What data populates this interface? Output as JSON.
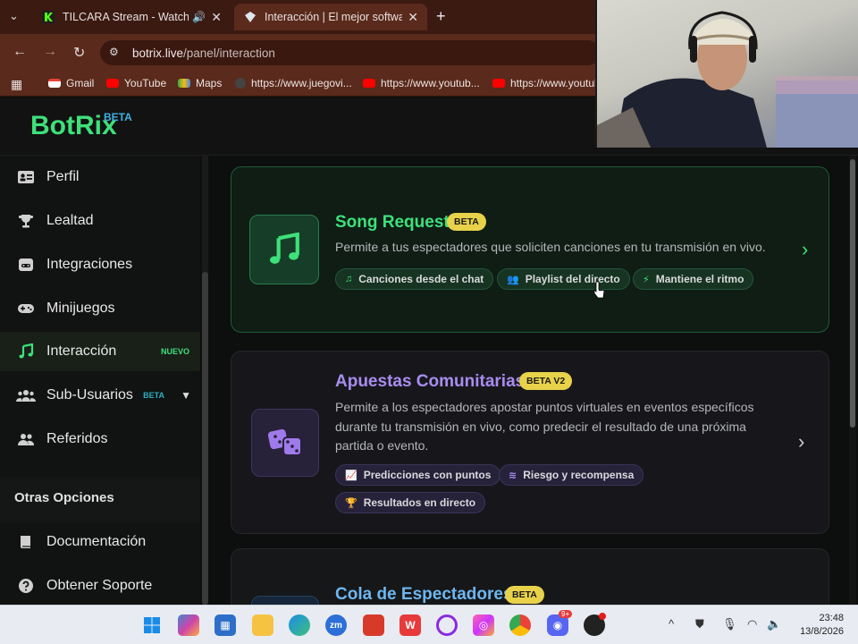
{
  "browser": {
    "tabs": [
      {
        "title": "TILCARA Stream - Watch Live",
        "favicon": "kick-icon",
        "active": false,
        "audio": true
      },
      {
        "title": "Interacción | El mejor software p",
        "favicon": "botrix-icon",
        "active": true,
        "audio": false
      }
    ],
    "url_host": "botrix.live",
    "url_path": "/panel/interaction",
    "bookmarks": [
      {
        "label": "Gmail",
        "icon": "gmail-icon"
      },
      {
        "label": "YouTube",
        "icon": "youtube-icon"
      },
      {
        "label": "Maps",
        "icon": "maps-icon"
      },
      {
        "label": "https://www.juegovi...",
        "icon": "site-icon"
      },
      {
        "label": "https://www.youtub...",
        "icon": "youtube-icon"
      },
      {
        "label": "https://www.youtub",
        "icon": "youtube-icon"
      }
    ]
  },
  "app": {
    "brand": "BotRix",
    "brand_badge": "BETA"
  },
  "sidebar": {
    "items": [
      {
        "label": "Perfil",
        "icon": "id-card-icon"
      },
      {
        "label": "Lealtad",
        "icon": "trophy-icon"
      },
      {
        "label": "Integraciones",
        "icon": "discord-icon"
      },
      {
        "label": "Minijuegos",
        "icon": "gamepad-icon"
      },
      {
        "label": "Interacción",
        "icon": "music-icon",
        "badge": "NUEVO",
        "active": true
      },
      {
        "label": "Sub-Usuarios",
        "icon": "users-icon",
        "badge": "BETA"
      },
      {
        "label": "Referidos",
        "icon": "user-group-icon"
      }
    ],
    "section_title": "Otras Opciones",
    "other_items": [
      {
        "label": "Documentación",
        "icon": "book-icon"
      },
      {
        "label": "Obtener Soporte",
        "icon": "question-icon"
      }
    ]
  },
  "cards": [
    {
      "title": "Song Request",
      "badge": "BETA",
      "description": "Permite a tus espectadores que soliciten canciones en tu transmisión en vivo.",
      "chips": [
        "Canciones desde el chat",
        "Playlist del directo",
        "Mantiene el ritmo"
      ],
      "accent": "#3ee07a"
    },
    {
      "title": "Apuestas Comunitarias",
      "badge": "BETA V2",
      "description_lines": [
        "Permite a los espectadores apostar puntos virtuales en eventos específicos",
        "durante tu transmisión en vivo, como predecir el resultado de una próxima",
        "partida o evento."
      ],
      "chips": [
        "Predicciones con puntos",
        "Riesgo y recompensa",
        "Resultados en directo"
      ],
      "accent": "#9f7aea"
    },
    {
      "title": "Cola de Espectadores",
      "badge": "BETA",
      "accent": "#5aa8e8"
    }
  ],
  "taskbar": {
    "time": "23:48",
    "date": "13/8/2026",
    "notification_badge": "9+"
  },
  "colors": {
    "accent_green": "#3ee07a",
    "accent_purple": "#9f7aea",
    "badge_yellow": "#e8d24a"
  }
}
